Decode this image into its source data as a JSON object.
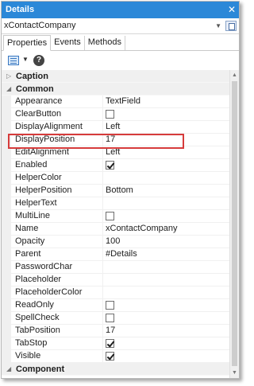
{
  "window": {
    "title": "Details"
  },
  "object_selector": {
    "value": "xContactCompany"
  },
  "tabs": [
    {
      "label": "Properties",
      "active": true
    },
    {
      "label": "Events",
      "active": false
    },
    {
      "label": "Methods",
      "active": false
    }
  ],
  "categories": {
    "caption": {
      "label": "Caption",
      "expanded": false
    },
    "common": {
      "label": "Common",
      "expanded": true
    },
    "component": {
      "label": "Component",
      "expanded": true
    }
  },
  "properties": [
    {
      "name": "Appearance",
      "value": "TextField",
      "type": "text"
    },
    {
      "name": "ClearButton",
      "value": "",
      "type": "checkbox",
      "checked": false
    },
    {
      "name": "DisplayAlignment",
      "value": "Left",
      "type": "text"
    },
    {
      "name": "DisplayPosition",
      "value": "17",
      "type": "text",
      "highlighted": true
    },
    {
      "name": "EditAlignment",
      "value": "Left",
      "type": "text"
    },
    {
      "name": "Enabled",
      "value": "",
      "type": "checkbox",
      "checked": true
    },
    {
      "name": "HelperColor",
      "value": "",
      "type": "text"
    },
    {
      "name": "HelperPosition",
      "value": "Bottom",
      "type": "text"
    },
    {
      "name": "HelperText",
      "value": "",
      "type": "text"
    },
    {
      "name": "MultiLine",
      "value": "",
      "type": "checkbox",
      "checked": false
    },
    {
      "name": "Name",
      "value": "xContactCompany",
      "type": "text"
    },
    {
      "name": "Opacity",
      "value": "100",
      "type": "text"
    },
    {
      "name": "Parent",
      "value": "#Details",
      "type": "text"
    },
    {
      "name": "PasswordChar",
      "value": "",
      "type": "text"
    },
    {
      "name": "Placeholder",
      "value": "",
      "type": "text"
    },
    {
      "name": "PlaceholderColor",
      "value": "",
      "type": "text"
    },
    {
      "name": "ReadOnly",
      "value": "",
      "type": "checkbox",
      "checked": false
    },
    {
      "name": "SpellCheck",
      "value": "",
      "type": "checkbox",
      "checked": false
    },
    {
      "name": "TabPosition",
      "value": "17",
      "type": "text"
    },
    {
      "name": "TabStop",
      "value": "",
      "type": "checkbox",
      "checked": true
    },
    {
      "name": "Visible",
      "value": "",
      "type": "checkbox",
      "checked": true
    }
  ],
  "colors": {
    "titlebar": "#2b88d8",
    "highlight_border": "#d63b3b"
  },
  "icons": [
    "close-icon",
    "chevron-down-icon",
    "new-window-icon",
    "categorized-view-icon",
    "help-icon",
    "expand-arrow-icon",
    "collapse-arrow-icon"
  ]
}
